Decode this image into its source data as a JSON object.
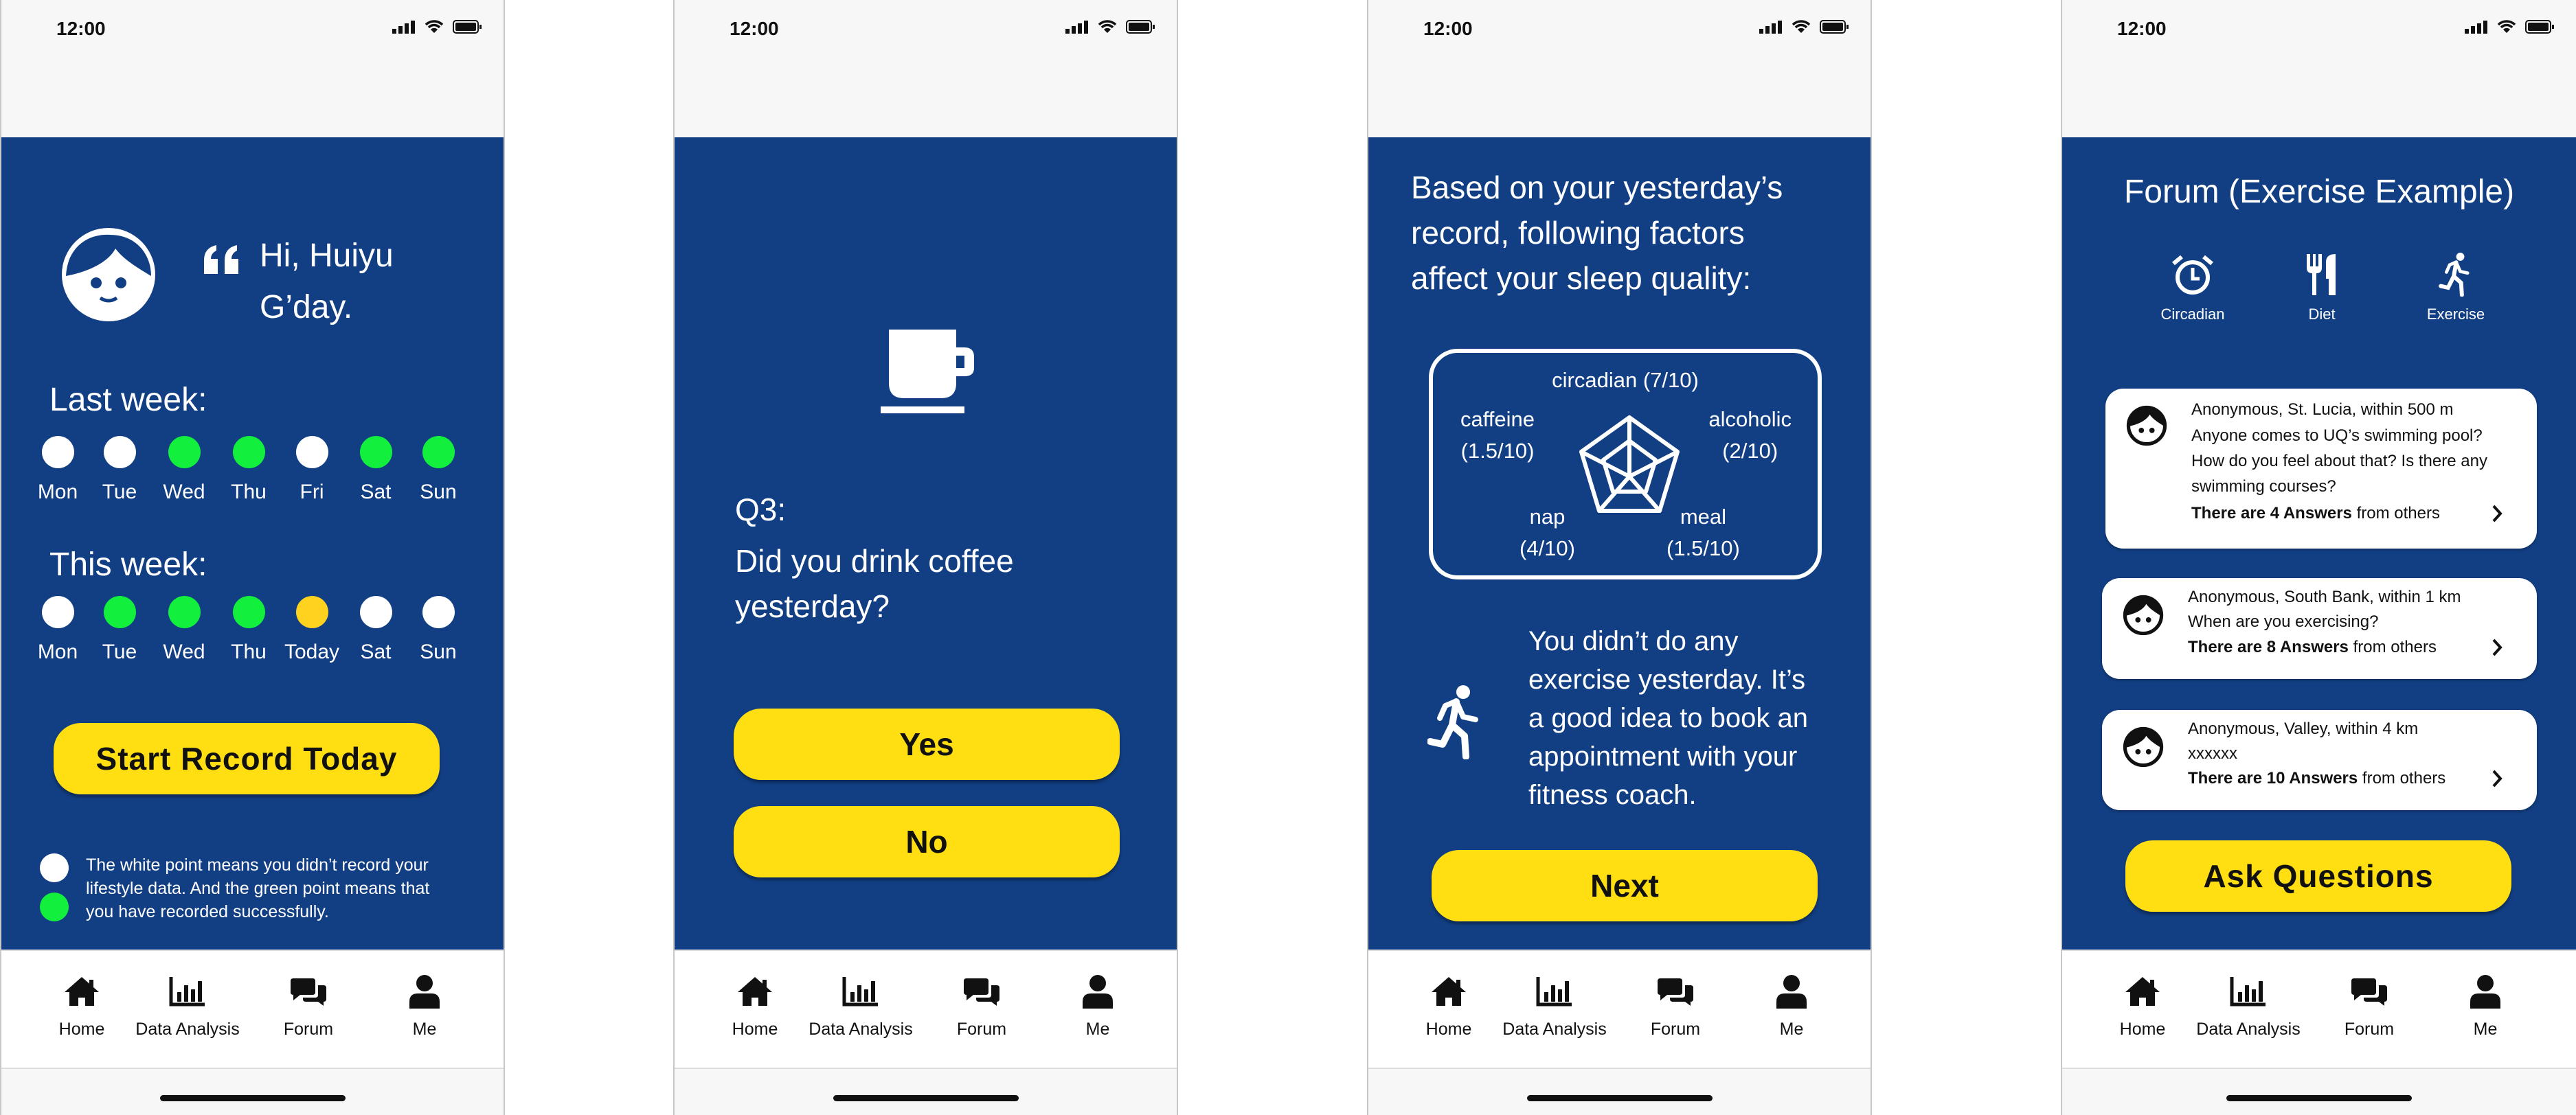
{
  "status": {
    "time": "12:00"
  },
  "colors": {
    "brand_blue": "#123f84",
    "accent_yellow": "#ffdf12",
    "recorded_green": "#12f03d",
    "today_yellow": "#ffd21f",
    "unrecorded_white": "#ffffff"
  },
  "tabs": [
    {
      "label": "Home",
      "icon": "home-icon"
    },
    {
      "label": "Data Analysis",
      "icon": "bar-chart-icon"
    },
    {
      "label": "Forum",
      "icon": "forum-icon"
    },
    {
      "label": "Me",
      "icon": "user-icon"
    }
  ],
  "screen1": {
    "greeting_line1": "Hi, Huiyu",
    "greeting_line2": "G’day.",
    "last_week_title": "Last week:",
    "this_week_title": "This week:",
    "last_week": [
      {
        "day": "Mon",
        "status": "white"
      },
      {
        "day": "Tue",
        "status": "white"
      },
      {
        "day": "Wed",
        "status": "green"
      },
      {
        "day": "Thu",
        "status": "green"
      },
      {
        "day": "Fri",
        "status": "white"
      },
      {
        "day": "Sat",
        "status": "green"
      },
      {
        "day": "Sun",
        "status": "green"
      }
    ],
    "this_week": [
      {
        "day": "Mon",
        "status": "white"
      },
      {
        "day": "Tue",
        "status": "green"
      },
      {
        "day": "Wed",
        "status": "green"
      },
      {
        "day": "Thu",
        "status": "green"
      },
      {
        "day": "Today",
        "status": "yellow"
      },
      {
        "day": "Sat",
        "status": "white"
      },
      {
        "day": "Sun",
        "status": "white"
      }
    ],
    "start_button": "Start Record Today",
    "legend_line1": "The white point means you didn’t record your",
    "legend_line2": "lifestyle data. And the green point means that",
    "legend_line3": "you have recorded successfully."
  },
  "screen2": {
    "question_number": "Q3:",
    "question_line1": "Did you drink coffee",
    "question_line2": "yesterday?",
    "yes_button": "Yes",
    "no_button": "No"
  },
  "screen3": {
    "heading_line1": "Based on your yesterday’s",
    "heading_line2": "record, following factors",
    "heading_line3": "affect your sleep quality:",
    "factor_circadian": "circadian (7/10)",
    "factor_caffeine_name": "caffeine",
    "factor_caffeine_score": "(1.5/10)",
    "factor_alcoholic_name": "alcoholic",
    "factor_alcoholic_score": "(2/10)",
    "factor_nap_name": "nap",
    "factor_nap_score": "(4/10)",
    "factor_meal_name": "meal",
    "factor_meal_score": "(1.5/10)",
    "advice_line1": "You didn’t do any",
    "advice_line2": "exercise yesterday. It’s",
    "advice_line3": "a good idea to book an",
    "advice_line4": "appointment with your",
    "advice_line5": "fitness coach.",
    "next_button": "Next"
  },
  "screen4": {
    "title": "Forum (Exercise Example)",
    "categories": [
      {
        "label": "Circadian",
        "icon": "alarm-clock-icon"
      },
      {
        "label": "Diet",
        "icon": "fork-knife-icon"
      },
      {
        "label": "Exercise",
        "icon": "running-icon"
      }
    ],
    "posts": [
      {
        "author": "Anonymous, St. Lucia, within 500 m",
        "line1": "Anyone comes to UQ’s swimming pool?",
        "line2": "How do you feel about that? Is there any",
        "line3": "swimming courses?",
        "answers_bold": "There are 4 Answers",
        "answers_rest": " from others"
      },
      {
        "author": "Anonymous, South Bank, within 1 km",
        "line1": "When are you exercising?",
        "answers_bold": "There are 8 Answers",
        "answers_rest": " from others"
      },
      {
        "author": "Anonymous, Valley, within 4 km",
        "line1": "xxxxxx",
        "answers_bold": "There are 10 Answers",
        "answers_rest": " from others"
      }
    ],
    "ask_button": "Ask Questions"
  }
}
